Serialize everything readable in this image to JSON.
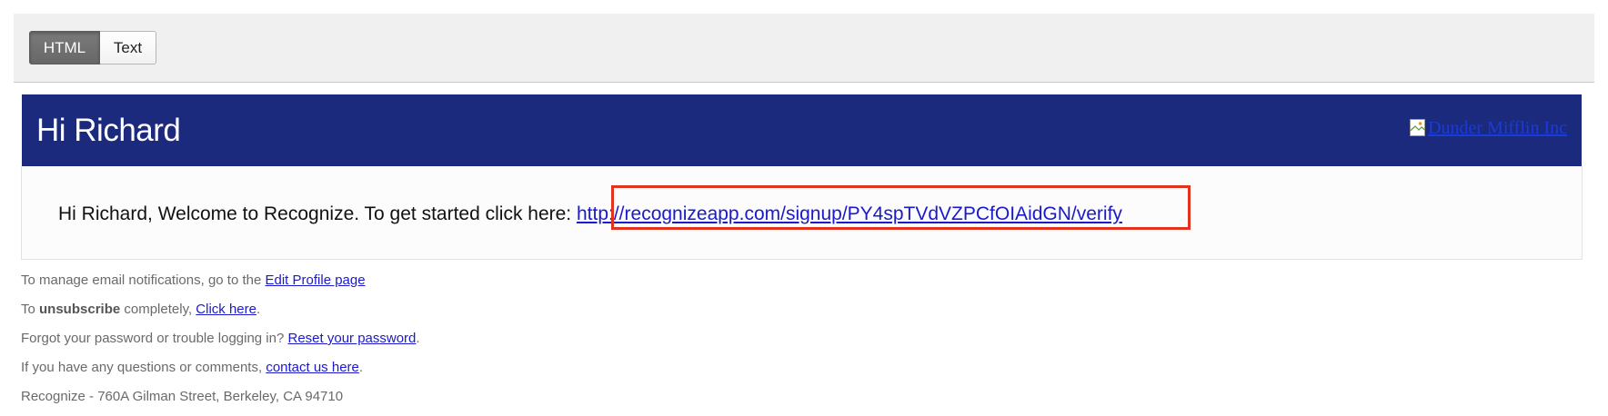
{
  "toolbar": {
    "tabs": [
      {
        "label": "HTML",
        "active": true
      },
      {
        "label": "Text",
        "active": false
      }
    ]
  },
  "email": {
    "header": {
      "greeting": "Hi Richard",
      "logo_alt": "Dunder Mifflin Inc",
      "background_color": "#1b2a7d"
    },
    "body": {
      "welcome_text": "Hi Richard, Welcome to Recognize. To get started click here: ",
      "signup_link": "http://recognizeapp.com/signup/PY4spTVdVZPCfOIAidGN/verify",
      "highlight_color": "#e2331f"
    },
    "footer": {
      "manage_prefix": "To manage email notifications, go to the ",
      "manage_link": "Edit Profile page",
      "unsub_prefix": "To ",
      "unsub_bold": "unsubscribe",
      "unsub_middle": " completely, ",
      "unsub_link": "Click here",
      "unsub_suffix": ".",
      "forgot_prefix": "Forgot your password or trouble logging in? ",
      "forgot_link": "Reset your password",
      "forgot_suffix": ".",
      "questions_prefix": "If you have any questions or comments, ",
      "questions_link": "contact us here",
      "questions_suffix": ".",
      "address": "Recognize - 760A Gilman Street, Berkeley, CA 94710"
    }
  }
}
